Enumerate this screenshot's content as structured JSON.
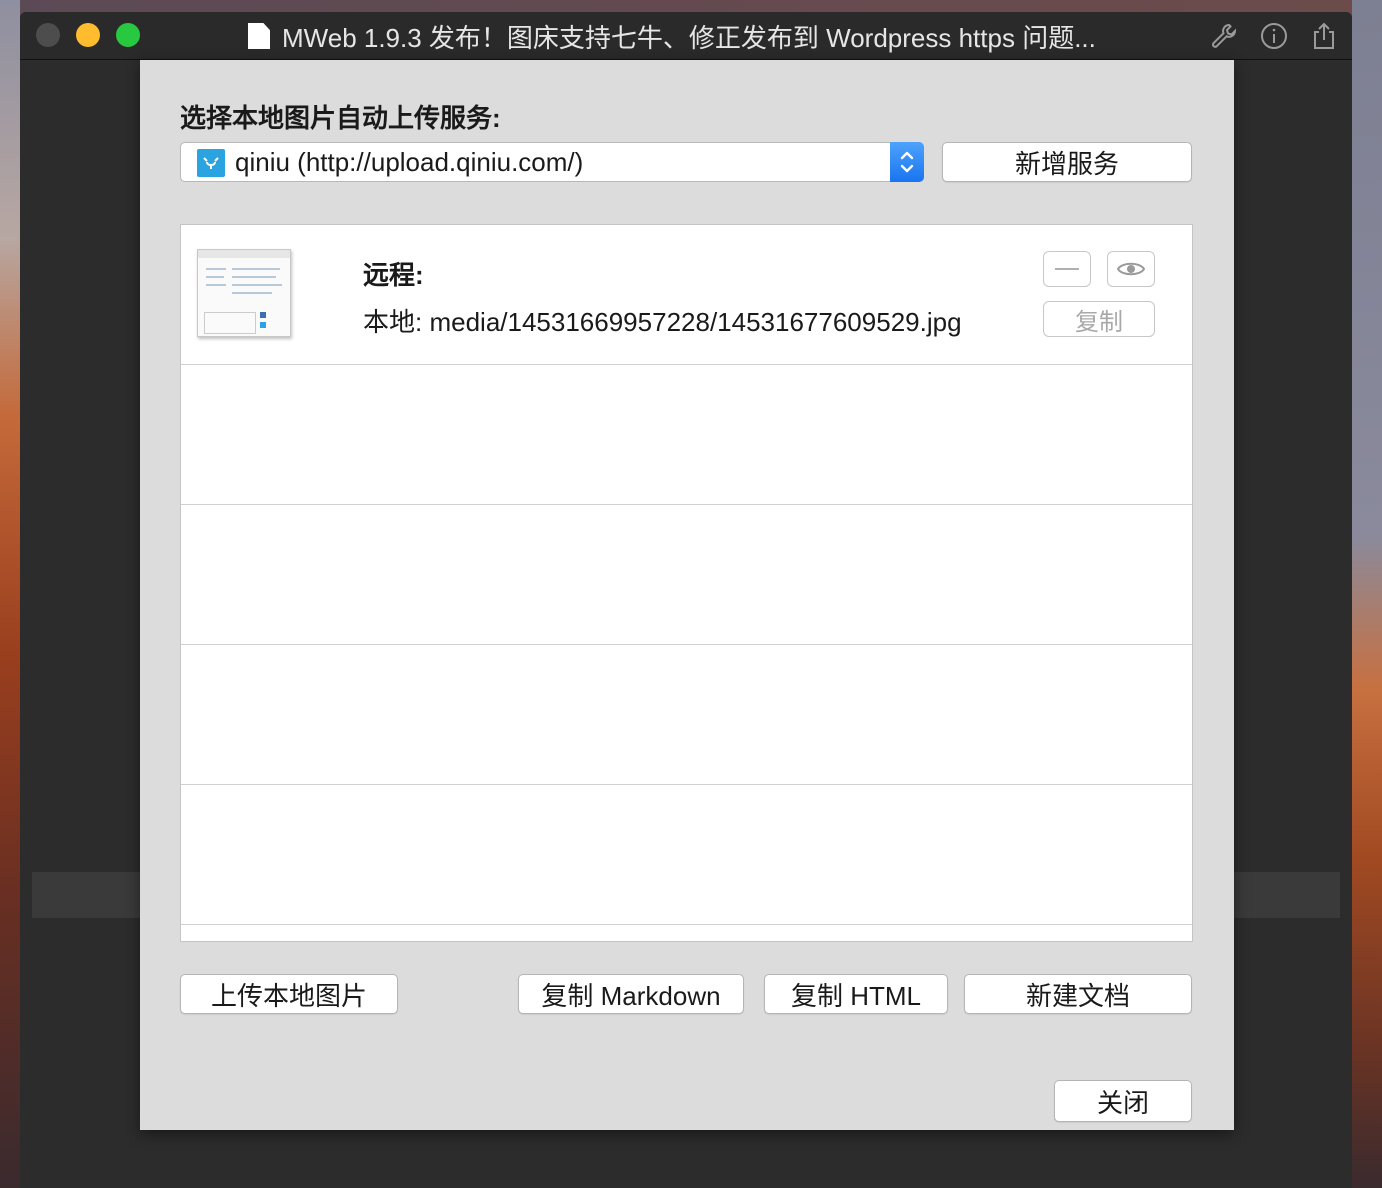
{
  "window": {
    "title": "MWeb 1.9.3 发布！图床支持七牛、修正发布到 Wordpress https 问题..."
  },
  "toolbar": {
    "wrench": "wrench-icon",
    "info": "info-icon",
    "share": "share-icon"
  },
  "sheet": {
    "service_label": "选择本地图片自动上传服务:",
    "service_selected": "qiniu (http://upload.qiniu.com/)",
    "add_service_label": "新增服务",
    "images": [
      {
        "remote_label": "远程:",
        "remote_value": "",
        "local_label": "本地:",
        "local_value": "media/14531669957228/14531677609529.jpg",
        "copy_label": "复制"
      }
    ],
    "upload_button": "上传本地图片",
    "copy_markdown_button": "复制 Markdown",
    "copy_html_button": "复制 HTML",
    "new_doc_button": "新建文档",
    "close_button": "关闭"
  },
  "colors": {
    "accent": "#1a74f0",
    "qiniu_icon": "#2aa4e0",
    "traffic_min": "#febc2e",
    "traffic_max": "#28c840"
  }
}
